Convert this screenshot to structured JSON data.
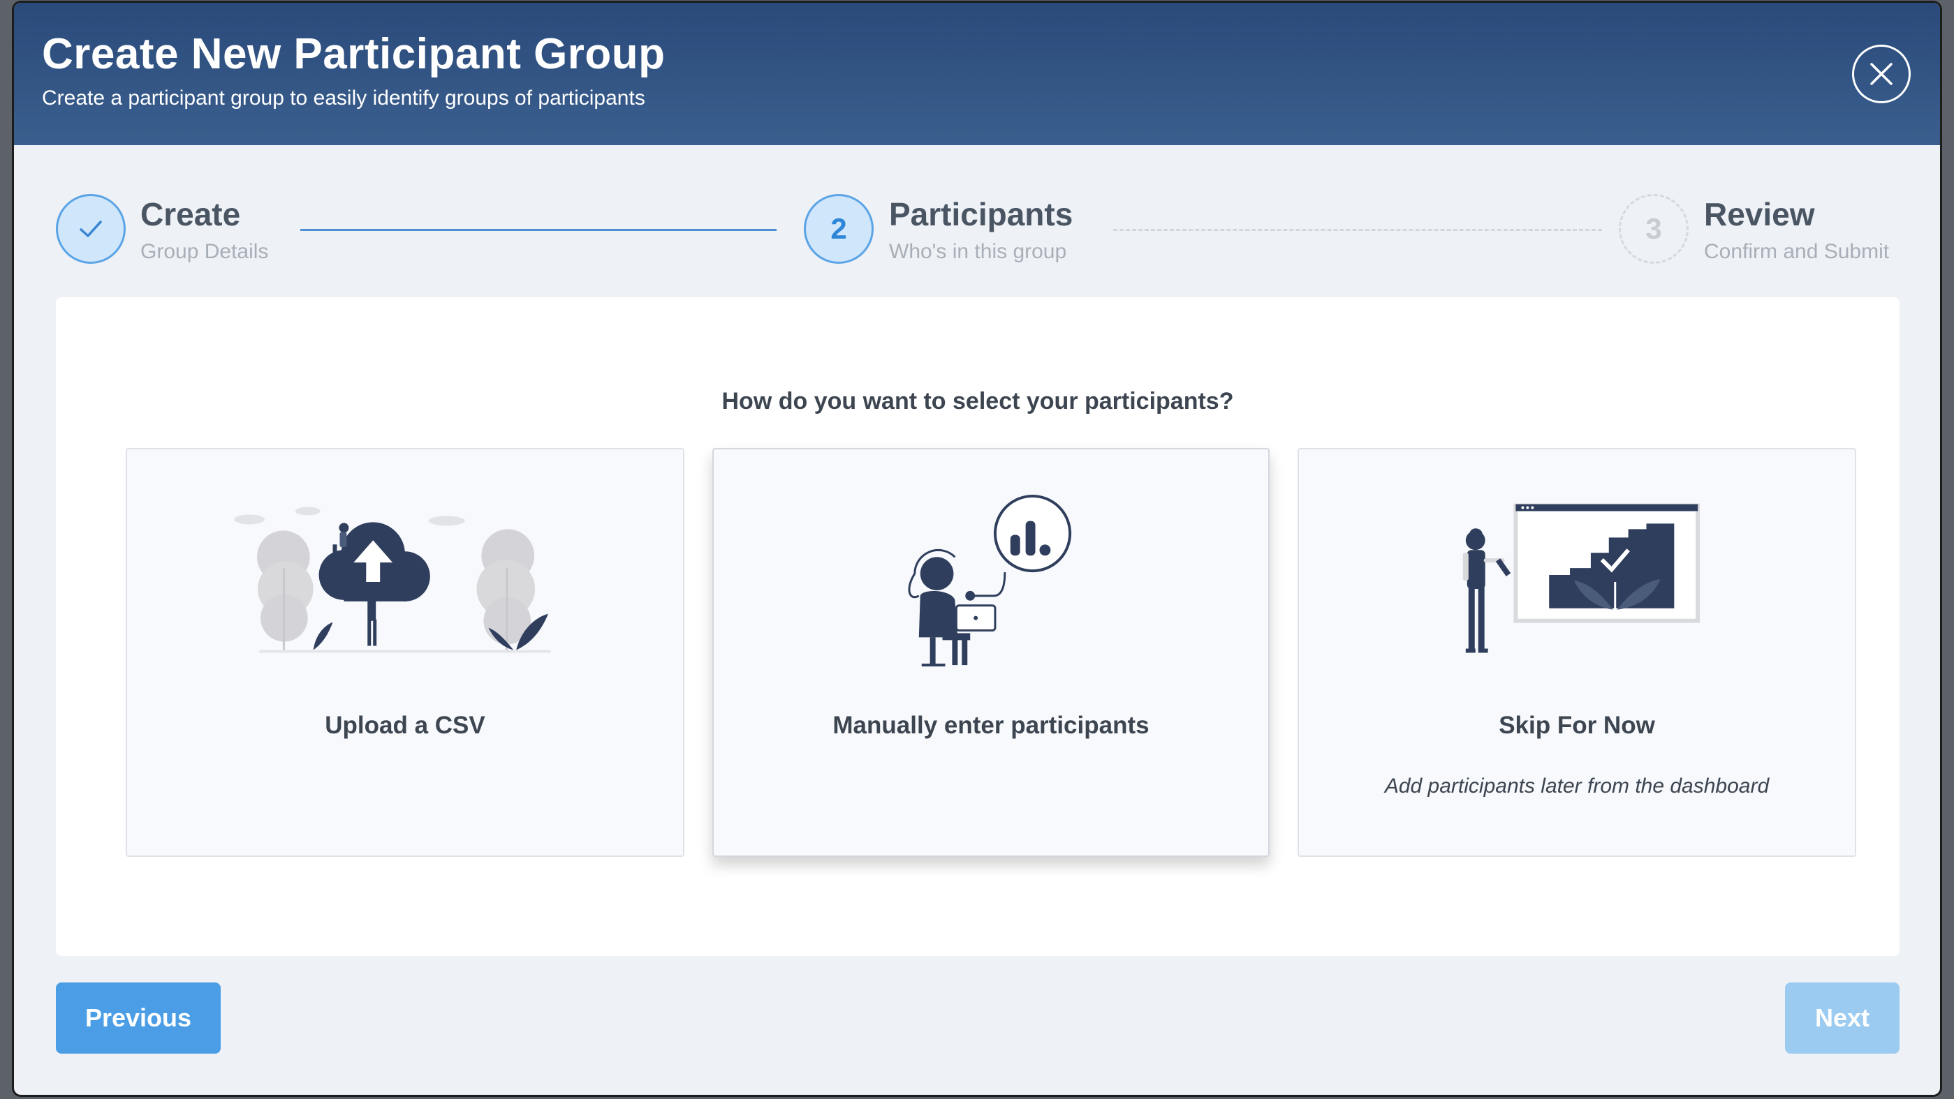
{
  "dialog": {
    "title": "Create New Participant Group",
    "subtitle": "Create a participant group to easily identify groups of participants"
  },
  "stepper": {
    "steps": [
      {
        "number": "",
        "title": "Create",
        "subtitle": "Group Details",
        "state": "completed"
      },
      {
        "number": "2",
        "title": "Participants",
        "subtitle": "Who's in this group",
        "state": "active"
      },
      {
        "number": "3",
        "title": "Review",
        "subtitle": "Confirm and Submit",
        "state": "pending"
      }
    ]
  },
  "main": {
    "question": "How do you want to select your participants?",
    "options": [
      {
        "label": "Upload a CSV",
        "description": "",
        "icon": "cloud-upload-illustration"
      },
      {
        "label": "Manually enter participants",
        "description": "",
        "icon": "person-laptop-illustration"
      },
      {
        "label": "Skip For Now",
        "description": "Add participants later from the dashboard",
        "icon": "dashboard-illustration"
      }
    ]
  },
  "footer": {
    "previous_label": "Previous",
    "next_label": "Next"
  },
  "colors": {
    "header": "#2a4a7a",
    "accent": "#4b9ee6",
    "next_disabled": "#9ccbf1",
    "illustration_dark": "#2f3e5c",
    "illustration_gray": "#d4d4d8"
  }
}
